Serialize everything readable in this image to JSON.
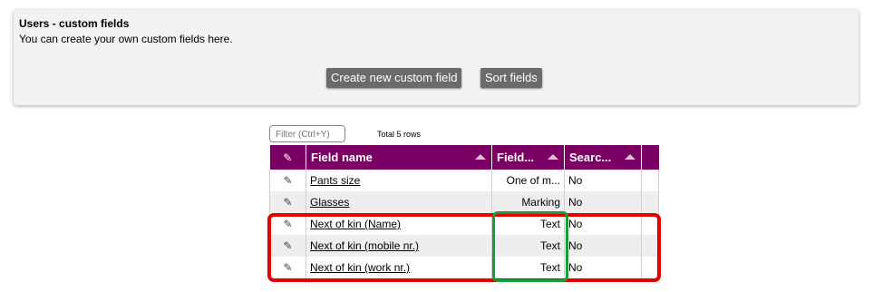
{
  "panel": {
    "title": "Users - custom fields",
    "description": "You can create your own custom fields here.",
    "create_button": "Create new custom field",
    "sort_button": "Sort fields"
  },
  "filter": {
    "placeholder": "Filter (Ctrl+Y)",
    "total_rows": "Total 5 rows"
  },
  "table": {
    "columns": [
      "Field name",
      "Field...",
      "Searc..."
    ],
    "rows": [
      {
        "name": "Pants size",
        "type": "One of m...",
        "searchable": "No"
      },
      {
        "name": "Glasses",
        "type": "Marking",
        "searchable": "No"
      },
      {
        "name": "Next of kin (Name)",
        "type": "Text",
        "searchable": "No"
      },
      {
        "name": "Next of kin (mobile nr.)",
        "type": "Text",
        "searchable": "No"
      },
      {
        "name": "Next of kin (work nr.)",
        "type": "Text",
        "searchable": "No"
      }
    ]
  },
  "colors": {
    "header_bg": "#7b0063",
    "button_bg": "#6b6b6b",
    "highlight_red": "#e60000",
    "highlight_green": "#1a9a3a"
  },
  "icons": {
    "edit": "pencil-icon",
    "sort": "sort-asc-icon"
  }
}
